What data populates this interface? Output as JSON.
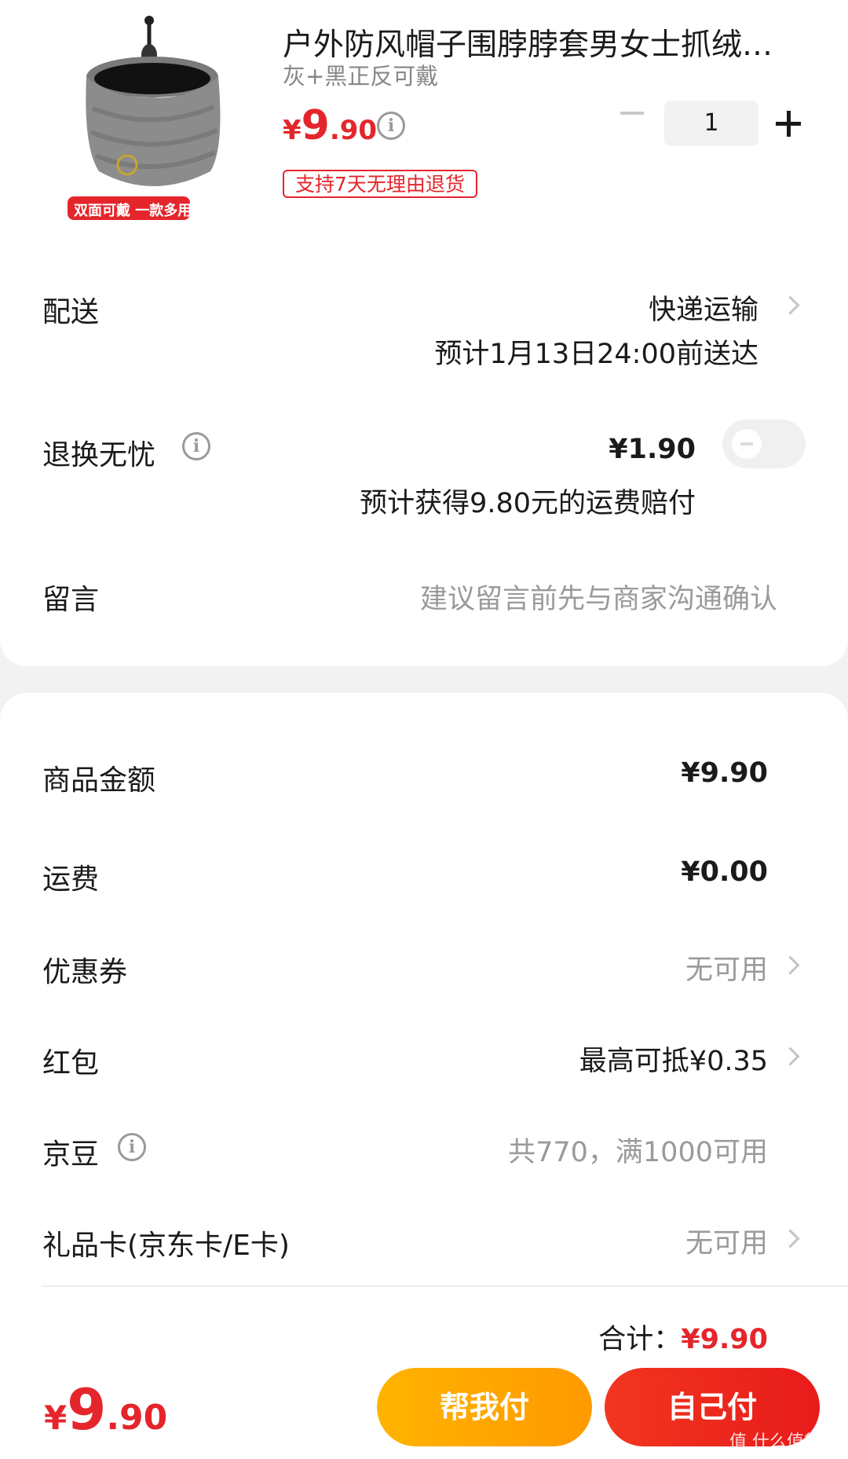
{
  "product": {
    "title": "户外防风帽子围脖脖套男女士抓绒保…",
    "variant": "灰+黑正反可戴",
    "price_currency": "¥",
    "price_int": "9",
    "price_dec": ".90",
    "image_caption": "双面可戴 一款多用",
    "return_tag": "支持7天无理由退货",
    "quantity": "1",
    "colors": {
      "price": "#e4262c",
      "neck_gaiter": "#8a8a8a"
    }
  },
  "delivery": {
    "label": "配送",
    "method": "快递运输",
    "eta": "预计1月13日24:00前送达"
  },
  "return_insurance": {
    "label": "退换无忧",
    "price": "¥1.90",
    "note": "预计获得9.80元的运费赔付",
    "enabled": false
  },
  "message": {
    "label": "留言",
    "placeholder": "建议留言前先与商家沟通确认"
  },
  "summary": {
    "goods_amount_label": "商品金额",
    "goods_amount": "¥9.90",
    "shipping_label": "运费",
    "shipping": "¥0.00",
    "coupon_label": "优惠券",
    "coupon_value": "无可用",
    "redpacket_label": "红包",
    "redpacket_value": "最高可抵¥0.35",
    "jingdou_label": "京豆",
    "jingdou_value": "共770，满1000可用",
    "giftcard_label": "礼品卡(京东卡/E卡)",
    "giftcard_value": "无可用",
    "total_label": "合计：",
    "total_value": "¥9.90"
  },
  "bottom_bar": {
    "price_currency": "¥",
    "price_int": "9",
    "price_dec": ".90",
    "help_pay_label": "帮我付",
    "self_pay_label": "自己付",
    "watermark": "值 什么值得买"
  }
}
